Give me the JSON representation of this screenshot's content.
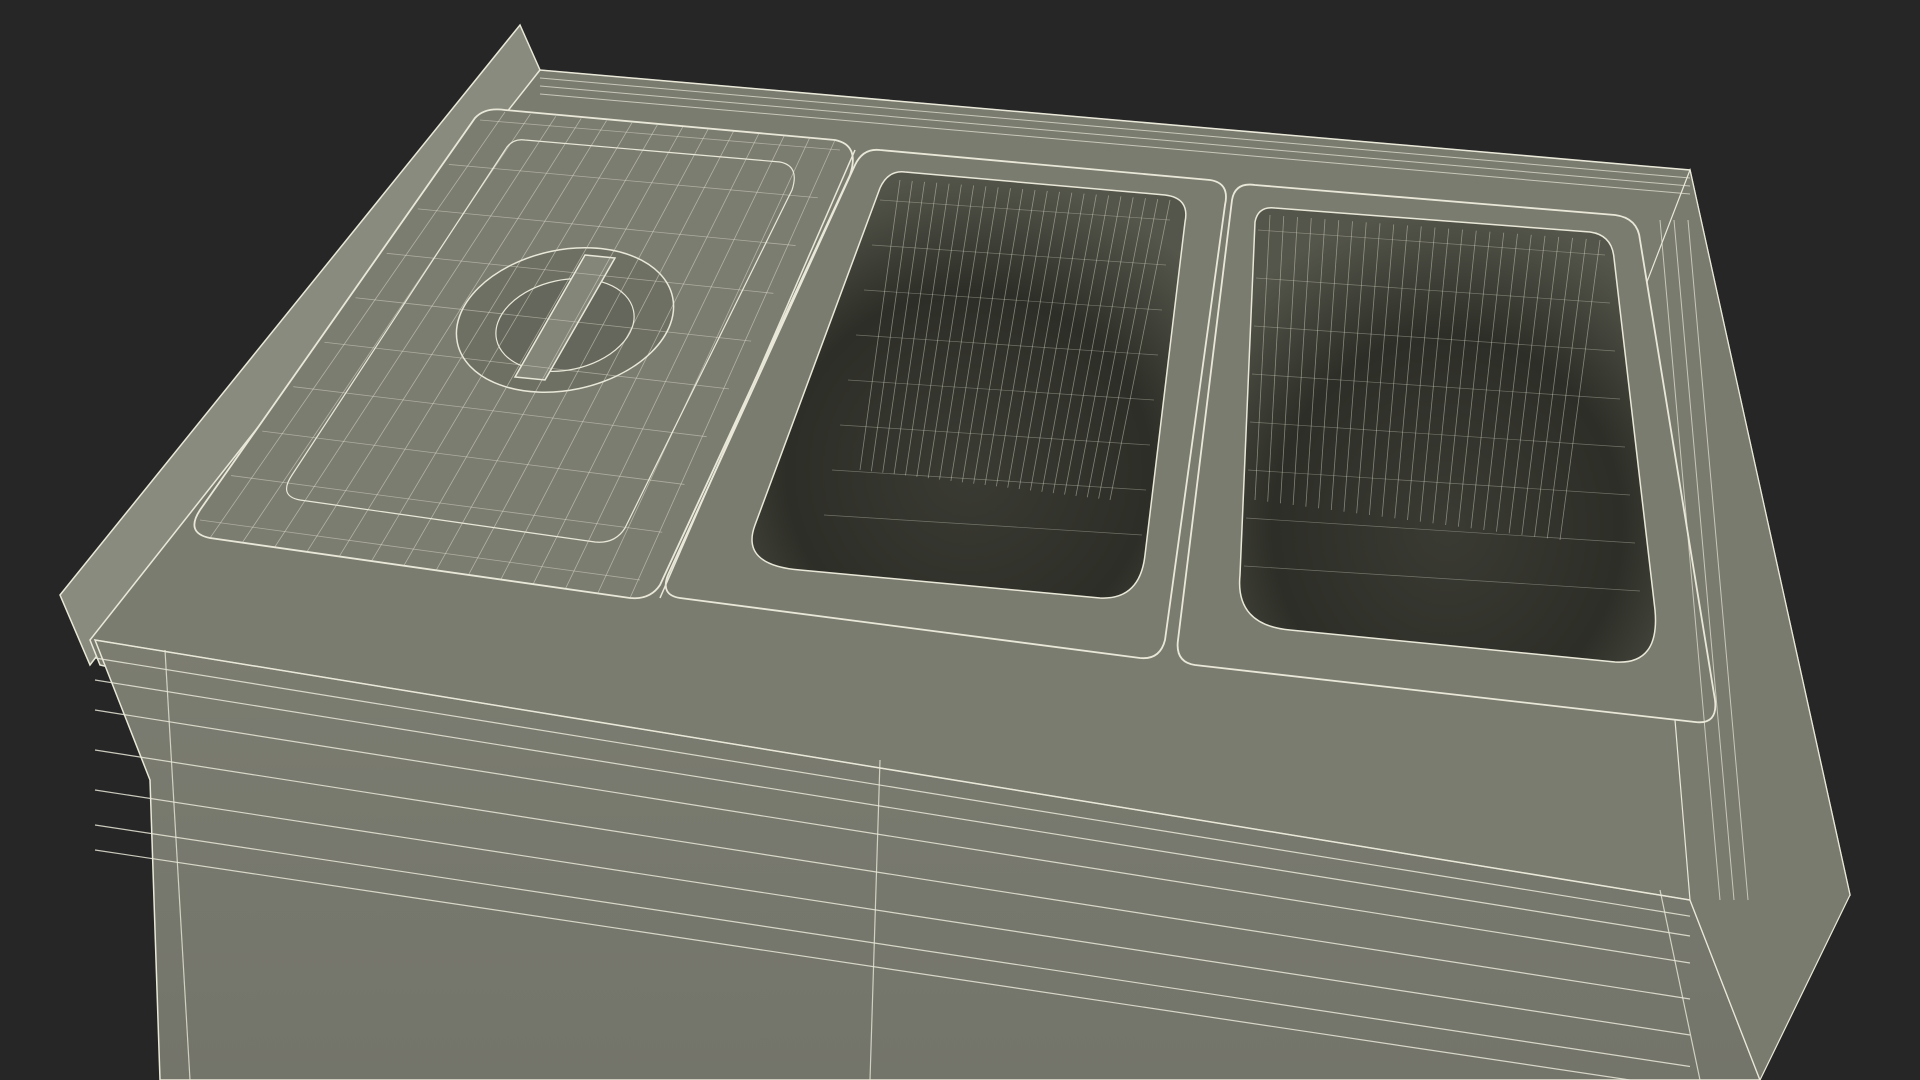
{
  "scene": {
    "background": "#262626",
    "surface_color": "#7b7c70",
    "surface_dark": "#6f7064",
    "inner_dark": "#2d2e27",
    "wire_color": "#e9e8d8",
    "object": "wireframe-food-warmer-counter",
    "wells": [
      {
        "id": "lidded-pan",
        "has_lid": true,
        "has_handle": true
      },
      {
        "id": "open-pan-middle",
        "has_lid": false
      },
      {
        "id": "open-pan-right",
        "has_lid": false
      }
    ]
  }
}
